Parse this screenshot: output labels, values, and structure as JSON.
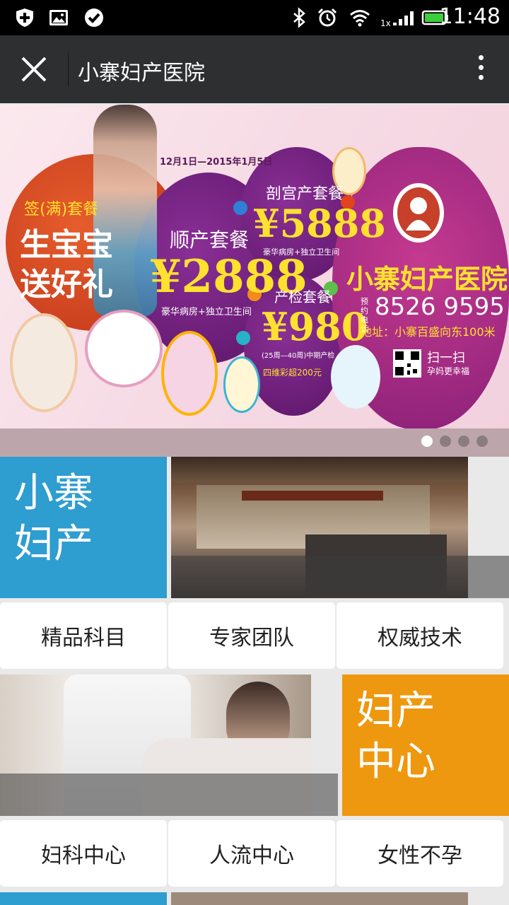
{
  "status_bar": {
    "time": "11:48",
    "signal_label": "1x",
    "icons": [
      "shield-plus-icon",
      "image-icon",
      "check-circle-icon",
      "bluetooth-icon",
      "alarm-icon",
      "wifi-icon",
      "signal-icon",
      "battery-icon"
    ]
  },
  "title_bar": {
    "title": "小寨妇产医院",
    "close_icon": "close-icon",
    "more_icon": "more-vertical-icon"
  },
  "banner": {
    "date_range": "12月1日—2015年1月5日",
    "left_promo_line1": "签(满)套餐",
    "left_promo_line2": "生宝宝",
    "left_promo_line3": "送好礼",
    "natural_package": "顺产套餐",
    "natural_price": "¥2888",
    "natural_note": "豪华病房+独立卫生间",
    "csection_package": "剖宫产套餐",
    "csection_price": "¥5888",
    "csection_note": "豪华病房+独立卫生间",
    "checkup_package": "产检套餐",
    "checkup_price": "¥980",
    "checkup_note": "(25周—40周)中期产检",
    "checkup_extra": "四维彩超200元",
    "hospital_name": "小寨妇产医院",
    "phone_label": "预约电话",
    "phone": "8526 9595",
    "address": "地址：小寨百盛向东100米",
    "scan_text": "扫一扫",
    "scan_sub": "孕妈更幸福",
    "page_count": 4,
    "active_page": 0,
    "colors": {
      "red": "#d9461f",
      "purple": "#6d1e7a",
      "magenta": "#b22c87",
      "yellow": "#ffe12f"
    }
  },
  "tiles": {
    "tile1_line1": "小寨",
    "tile1_line2": "妇产",
    "tile2_line1": "妇产",
    "tile2_line2": "中心",
    "tile1_color": "#2e9dd0",
    "tile2_color": "#ee980f"
  },
  "buttons_row1": [
    "精品科目",
    "专家团队",
    "权威技术"
  ],
  "buttons_row2": [
    "妇科中心",
    "人流中心",
    "女性不孕"
  ]
}
